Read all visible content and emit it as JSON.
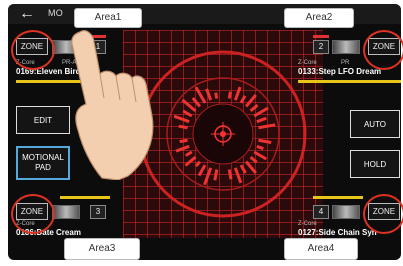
{
  "topbar": {
    "back_icon": "arrow-left-icon",
    "title": "MO"
  },
  "areas": [
    "Area1",
    "Area2",
    "Area3",
    "Area4"
  ],
  "zones": [
    {
      "zone_label": "ZONE",
      "number": "1",
      "engine": "Z-Core",
      "bank": "PR-A",
      "patch": "0169:Eleven Birds"
    },
    {
      "zone_label": "ZONE",
      "number": "2",
      "engine": "Z-Core",
      "bank": "PR",
      "patch": "0133:Step LFO Dream"
    },
    {
      "zone_label": "ZONE",
      "number": "3",
      "engine": "Z-Core",
      "bank": "",
      "patch": "0186:Date Cream"
    },
    {
      "zone_label": "ZONE",
      "number": "4",
      "engine": "Z-Core",
      "bank": "",
      "patch": "0127:Side Chain Syn"
    }
  ],
  "buttons": {
    "edit": "EDIT",
    "motional_pad": "MOTIONAL PAD",
    "auto": "AUTO",
    "hold": "HOLD"
  },
  "colors": {
    "accent_red": "#dd2222",
    "zone_yellow": "#e8c51a"
  },
  "icons": {
    "hand": "hand-pointer-icon",
    "center": "crosshair-icon"
  }
}
